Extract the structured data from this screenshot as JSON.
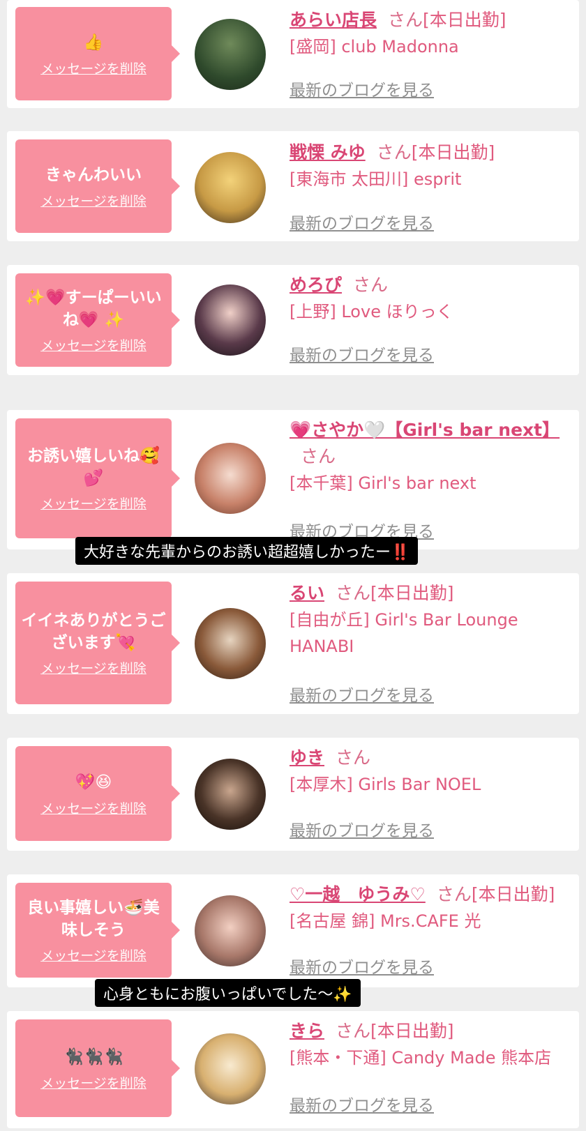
{
  "cards": [
    {
      "message": "👍",
      "delete_label": "メッセージを削除",
      "name": "あらい店長",
      "suffix": "さん",
      "status": "[本日出勤]",
      "shop": "[盛岡] club Madonna",
      "blog_link": "最新のブログを見る"
    },
    {
      "message": "きゃんわいい",
      "delete_label": "メッセージを削除",
      "name": "戦慄 みゆ",
      "suffix": "さん",
      "status": "[本日出勤]",
      "shop": "[東海市 太田川] esprit",
      "blog_link": "最新のブログを見る"
    },
    {
      "message": "✨💗すーぱーいいね💗 ✨",
      "delete_label": "メッセージを削除",
      "name": "めろぴ",
      "suffix": "さん",
      "status": "",
      "shop": "[上野] Love ほりっく",
      "blog_link": "最新のブログを見る"
    },
    {
      "message": "お誘い嬉しいね🥰💕",
      "delete_label": "メッセージを削除",
      "name": "💗さやか🤍【Girl's bar next】",
      "suffix": "さん",
      "status": "",
      "shop": "[本千葉] Girl's bar next",
      "blog_link": "最新のブログを見る"
    },
    {
      "message": "イイネありがとうございます💘",
      "delete_label": "メッセージを削除",
      "name": "るい",
      "suffix": "さん",
      "status": "[本日出勤]",
      "shop": "[自由が丘] Girl's Bar Lounge HANABI",
      "blog_link": "最新のブログを見る"
    },
    {
      "message": "💖😆",
      "delete_label": "メッセージを削除",
      "name": "ゆき",
      "suffix": "さん",
      "status": "",
      "shop": "[本厚木] Girls Bar NOEL",
      "blog_link": "最新のブログを見る"
    },
    {
      "message": "良い事嬉しい🍜美味しそう",
      "delete_label": "メッセージを削除",
      "name": "♡一越　ゆうみ♡",
      "suffix": "さん",
      "status": "[本日出勤]",
      "shop": "[名古屋 錦] Mrs.CAFE 光",
      "blog_link": "最新のブログを見る"
    },
    {
      "message": "🐈‍⬛🐈‍⬛🐈‍⬛",
      "delete_label": "メッセージを削除",
      "name": "きら",
      "suffix": "さん",
      "status": "[本日出勤]",
      "shop": "[熊本・下通] Candy Made 熊本店",
      "blog_link": "最新のブログを見る"
    }
  ],
  "captions": [
    "大好きな先輩からのお誘い超超嬉しかったー‼️",
    "心身ともにお腹いっぱいでした～✨"
  ],
  "colors": {
    "bubble": "#f8909f",
    "name": "#d94674",
    "text": "#e05a7e",
    "link": "#8f8f8f",
    "background": "#eeeeee"
  }
}
